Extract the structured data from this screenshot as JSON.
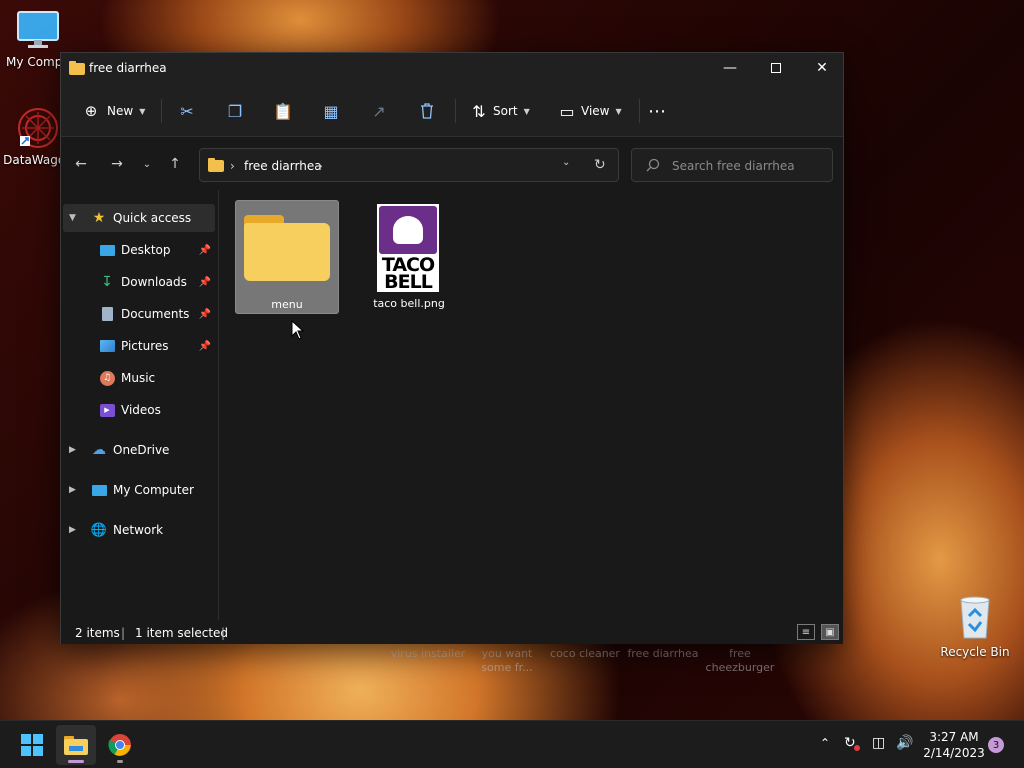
{
  "desktop": {
    "icons": [
      {
        "label": "My Compu"
      },
      {
        "label": "DataWagon"
      },
      {
        "label": "Recycle Bin"
      }
    ],
    "background_labels": [
      "virus installer",
      "you want some fr...",
      "coco cleaner",
      "free diarrhea",
      "free cheezburger"
    ]
  },
  "window": {
    "title": "free diarrhea",
    "toolbar": {
      "new_label": "New",
      "sort_label": "Sort",
      "view_label": "View"
    },
    "address": {
      "crumbs": [
        "free diarrhea"
      ]
    },
    "search": {
      "placeholder": "Search free diarrhea"
    },
    "sidebar": {
      "quick_access": "Quick access",
      "items": [
        {
          "label": "Desktop"
        },
        {
          "label": "Downloads"
        },
        {
          "label": "Documents"
        },
        {
          "label": "Pictures"
        },
        {
          "label": "Music"
        },
        {
          "label": "Videos"
        }
      ],
      "onedrive": "OneDrive",
      "my_computer": "My Computer",
      "network": "Network"
    },
    "files": [
      {
        "name": "menu",
        "type": "folder",
        "selected": true
      },
      {
        "name": "taco bell.png",
        "type": "image",
        "logo_text_1": "TACO",
        "logo_text_2": "BELL"
      }
    ],
    "status": {
      "items_count": "2 items",
      "selection": "1 item selected"
    }
  },
  "taskbar": {
    "time": "3:27 AM",
    "date": "2/14/2023",
    "notification_count": "3"
  },
  "colors": {
    "accent": "#8fc3ff",
    "folder": "#f6cf5e",
    "taco_purple": "#6b2f8a"
  }
}
